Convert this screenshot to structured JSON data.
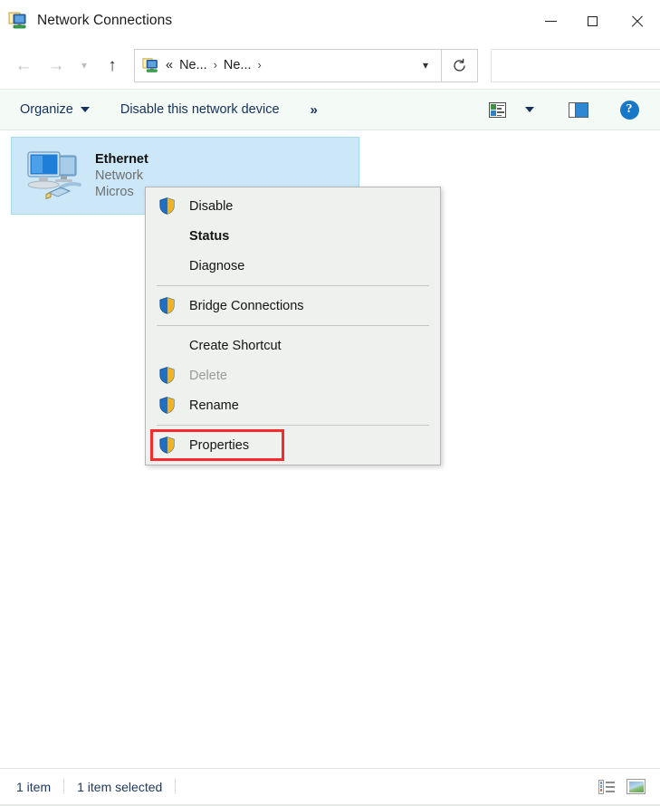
{
  "window": {
    "title": "Network Connections",
    "title_icon": "network-connections-icon",
    "controls": {
      "minimize": "minimize-button",
      "maximize": "maximize-button",
      "close": "close-button"
    }
  },
  "navbar": {
    "back": "back-arrow-icon",
    "forward": "forward-arrow-icon",
    "recent": "recent-locations-chevron-icon",
    "up": "up-arrow-icon",
    "address_icon": "network-connections-icon",
    "breadcrumbs": [
      {
        "label": "«",
        "separator": ""
      },
      {
        "label": "Ne...",
        "separator": "›"
      },
      {
        "label": "Ne...",
        "separator": "›"
      }
    ],
    "dropdown": "⌄",
    "refresh": "↻",
    "search_value": "",
    "search_placeholder": ""
  },
  "toolbar": {
    "organize_label": "Organize",
    "disable_device_label": "Disable this network device",
    "overflow_label": "»",
    "view_options_icon": "change-view-icon",
    "view_dropdown_icon": "view-dropdown-caret-icon",
    "preview_pane_icon": "preview-pane-icon",
    "help_icon": "help-icon",
    "help_glyph": "?"
  },
  "connection": {
    "name": "Ethernet",
    "network": "Network",
    "adapter": "Micros",
    "icon": "ethernet-adapter-icon",
    "selected": true
  },
  "context_menu": {
    "items": [
      {
        "label": "Disable",
        "icon": "shield-icon",
        "bold": false,
        "disabled": false,
        "type": "item"
      },
      {
        "label": "Status",
        "icon": "",
        "bold": true,
        "disabled": false,
        "type": "item"
      },
      {
        "label": "Diagnose",
        "icon": "",
        "bold": false,
        "disabled": false,
        "type": "item"
      },
      {
        "label": "",
        "icon": "",
        "bold": false,
        "disabled": false,
        "type": "separator"
      },
      {
        "label": "Bridge Connections",
        "icon": "shield-icon",
        "bold": false,
        "disabled": false,
        "type": "item"
      },
      {
        "label": "",
        "icon": "",
        "bold": false,
        "disabled": false,
        "type": "separator"
      },
      {
        "label": "Create Shortcut",
        "icon": "",
        "bold": false,
        "disabled": false,
        "type": "item"
      },
      {
        "label": "Delete",
        "icon": "shield-icon",
        "bold": false,
        "disabled": true,
        "type": "item"
      },
      {
        "label": "Rename",
        "icon": "shield-icon",
        "bold": false,
        "disabled": false,
        "type": "item"
      },
      {
        "label": "",
        "icon": "",
        "bold": false,
        "disabled": false,
        "type": "separator"
      },
      {
        "label": "Properties",
        "icon": "shield-icon",
        "bold": false,
        "disabled": false,
        "type": "item"
      }
    ],
    "highlighted_item": "Properties",
    "highlight_color": "#f42c2c"
  },
  "statusbar": {
    "item_count": "1 item",
    "selection": "1 item selected",
    "details_view_icon": "details-view-icon",
    "large_icons_view_icon": "large-icons-view-icon"
  },
  "colors": {
    "selection_bg": "#cce8f8",
    "toolbar_bg": "#f4faf6",
    "menu_bg": "#eef1ee",
    "accent_text": "#1f3864"
  }
}
